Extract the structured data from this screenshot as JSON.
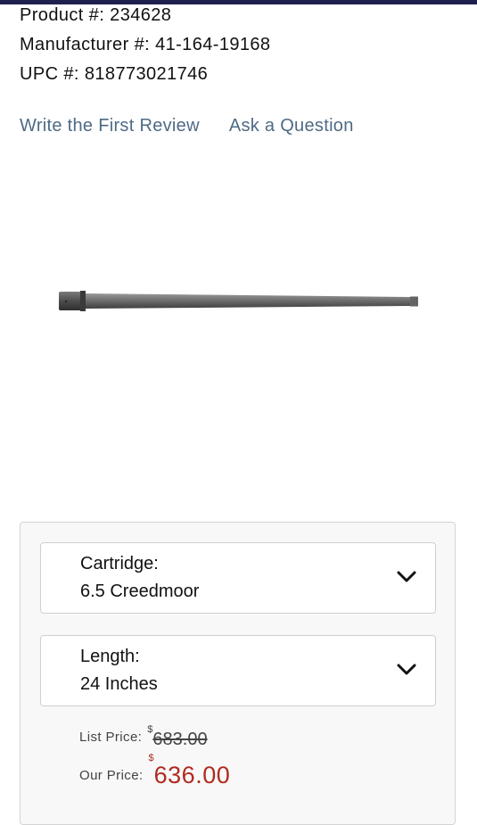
{
  "product": {
    "product_label": "Product #:",
    "product_number": "234628",
    "manufacturer_label": "Manufacturer #:",
    "manufacturer_number": "41-164-19168",
    "upc_label": "UPC #:",
    "upc_number": "818773021746"
  },
  "links": {
    "review": "Write the First Review",
    "question": "Ask a Question"
  },
  "image": {
    "icon": "rifle-barrel-image"
  },
  "options": {
    "cartridge_label": "Cartridge:",
    "cartridge_value": "6.5 Creedmoor",
    "length_label": "Length:",
    "length_value": "24 Inches"
  },
  "pricing": {
    "list_label": "List Price:",
    "list_currency": "$",
    "list_amount": "683.00",
    "our_label": "Our Price:",
    "our_currency": "$",
    "our_amount": "636.00",
    "sale_color": "#b02a20"
  },
  "colors": {
    "top_bar": "#1f2050",
    "link": "#4e6a85"
  }
}
